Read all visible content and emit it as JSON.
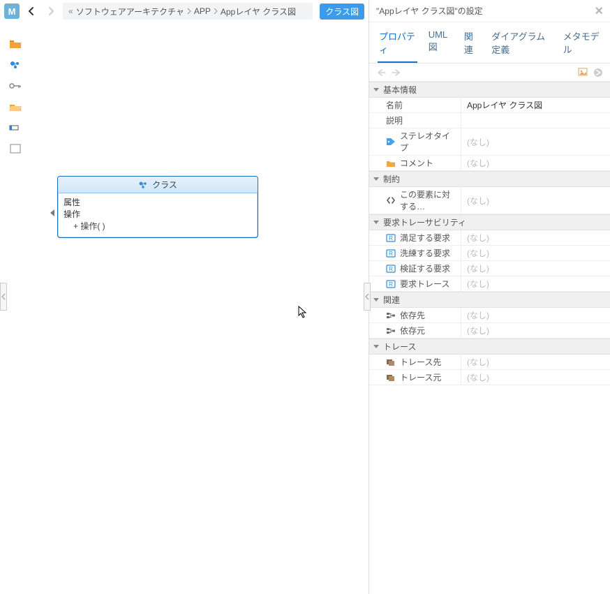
{
  "topbar": {
    "home_letter": "M",
    "breadcrumb_prefix": "«",
    "breadcrumb": [
      "ソフトウェアアーキテクチャ",
      "APP",
      "Appレイヤ クラス図"
    ],
    "diagram_type_badge": "クラス図"
  },
  "canvas": {
    "class_node": {
      "title": "クラス",
      "attr_section": "属性",
      "op_section": "操作",
      "operations": [
        "+ 操作( )"
      ]
    }
  },
  "props_panel": {
    "title": "\"Appレイヤ クラス図\"の設定",
    "tabs": [
      "プロパティ",
      "UML図",
      "関連",
      "ダイアグラム定義",
      "メタモデル"
    ],
    "active_tab_index": 0,
    "none_placeholder": "(なし)",
    "groups": [
      {
        "title": "基本情報",
        "rows": [
          {
            "icon": null,
            "label": "名前",
            "value": "Appレイヤ クラス図",
            "placeholder": false
          },
          {
            "icon": null,
            "label": "説明",
            "value": "",
            "placeholder": false
          },
          {
            "icon": "tag",
            "label": "ステレオタイプ",
            "value": "(なし)",
            "placeholder": true
          },
          {
            "icon": "folder",
            "label": "コメント",
            "value": "(なし)",
            "placeholder": true
          }
        ]
      },
      {
        "title": "制約",
        "rows": [
          {
            "icon": "code",
            "label": "この要素に対する…",
            "value": "(なし)",
            "placeholder": true
          }
        ]
      },
      {
        "title": "要求トレーサビリティ",
        "rows": [
          {
            "icon": "req",
            "label": "満足する要求",
            "value": "(なし)",
            "placeholder": true
          },
          {
            "icon": "req",
            "label": "洗練する要求",
            "value": "(なし)",
            "placeholder": true
          },
          {
            "icon": "req",
            "label": "検証する要求",
            "value": "(なし)",
            "placeholder": true
          },
          {
            "icon": "req",
            "label": "要求トレース",
            "value": "(なし)",
            "placeholder": true
          }
        ]
      },
      {
        "title": "関連",
        "rows": [
          {
            "icon": "dep",
            "label": "依存先",
            "value": "(なし)",
            "placeholder": true
          },
          {
            "icon": "dep",
            "label": "依存元",
            "value": "(なし)",
            "placeholder": true
          }
        ]
      },
      {
        "title": "トレース",
        "rows": [
          {
            "icon": "trace",
            "label": "トレース先",
            "value": "(なし)",
            "placeholder": true
          },
          {
            "icon": "trace",
            "label": "トレース元",
            "value": "(なし)",
            "placeholder": true
          }
        ]
      }
    ]
  }
}
